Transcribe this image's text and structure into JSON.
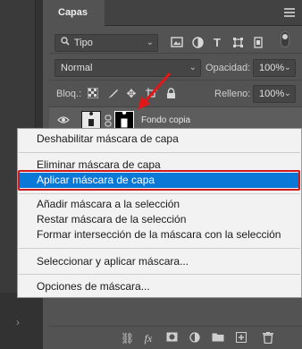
{
  "panel": {
    "tab_label": "Capas"
  },
  "filter": {
    "kind_value": "Tipo",
    "icons": [
      "image-icon",
      "adjustment-circle-icon",
      "type-T-icon",
      "shape-transform-icon",
      "smart-object-icon"
    ]
  },
  "blend": {
    "mode_value": "Normal",
    "opacity_label": "Opacidad:",
    "opacity_value": "100%"
  },
  "lock": {
    "label": "Bloq.:",
    "icons": [
      "lock-transparent-pixels-icon",
      "lock-image-pixels-icon",
      "lock-position-icon",
      "artboard-icon",
      "lock-all-icon"
    ],
    "fill_label": "Relleno:",
    "fill_value": "100%"
  },
  "layer": {
    "name": "Fondo copia"
  },
  "context_menu": {
    "groups": [
      [
        {
          "label": "Deshabilitar máscara de capa"
        }
      ],
      [
        {
          "label": "Eliminar máscara de capa"
        },
        {
          "label": "Aplicar máscara de capa",
          "selected": true
        }
      ],
      [
        {
          "label": "Añadir máscara a la selección"
        },
        {
          "label": "Restar máscara de la selección"
        },
        {
          "label": "Formar intersección de la máscara con la selección"
        }
      ],
      [
        {
          "label": "Seleccionar y aplicar máscara..."
        }
      ],
      [
        {
          "label": "Opciones de máscara..."
        }
      ]
    ]
  },
  "bottom_icons": [
    "link-layers-icon",
    "fx-icon",
    "add-mask-icon",
    "new-adjustment-icon",
    "new-group-icon",
    "new-layer-icon",
    "delete-layer-icon"
  ],
  "colors": {
    "selection": "#0a78d7",
    "highlight_box": "#d11a1a",
    "arrow": "#e01818"
  }
}
